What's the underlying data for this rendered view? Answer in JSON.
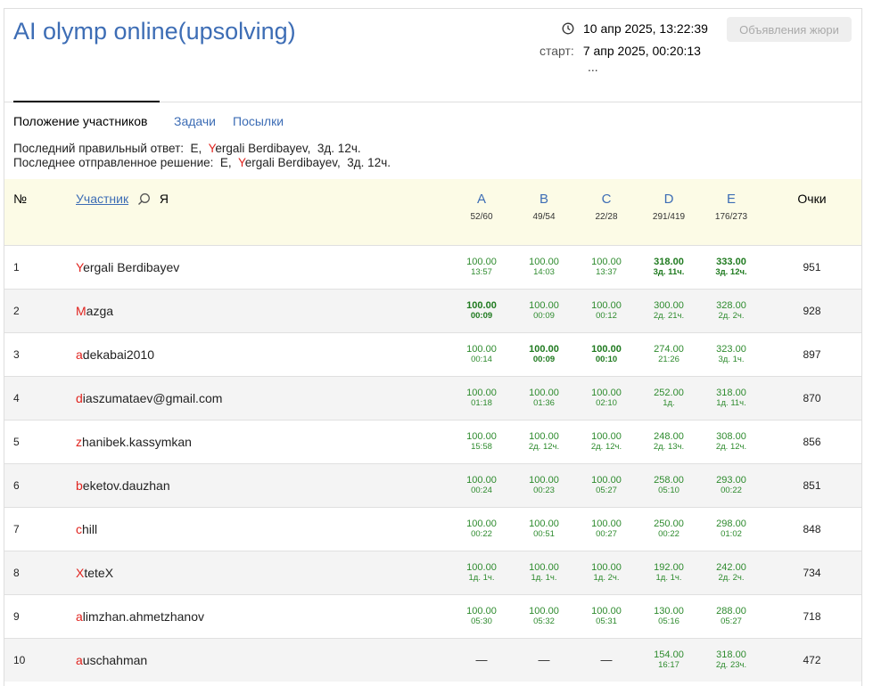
{
  "contest": {
    "title": "AI olymp online(upsolving)",
    "current_time": "10 апр 2025, 13:22:39",
    "start_label": "старт:",
    "start_time": "7 апр 2025, 00:20:13",
    "ellipsis": "...",
    "jury_button": "Объявления жюри"
  },
  "tabs": [
    {
      "label": "Положение участников"
    },
    {
      "label": "Задачи"
    },
    {
      "label": "Посылки"
    }
  ],
  "info": {
    "last_correct_label": "Последний правильный ответ:",
    "last_correct_problem": "E,",
    "last_correct_user_first": "Y",
    "last_correct_user_rest": "ergali Berdibayev,",
    "last_correct_time": "3д. 12ч.",
    "last_submit_label": "Последнее отправленное решение:",
    "last_submit_problem": "E,",
    "last_submit_user_first": "Y",
    "last_submit_user_rest": "ergali Berdibayev,",
    "last_submit_time": "3д. 12ч."
  },
  "table": {
    "col_num": "№",
    "col_participant": "Участник",
    "col_me": "Я",
    "col_score": "Очки",
    "problems": [
      {
        "letter": "A",
        "ratio": "52/60"
      },
      {
        "letter": "B",
        "ratio": "49/54"
      },
      {
        "letter": "C",
        "ratio": "22/28"
      },
      {
        "letter": "D",
        "ratio": "291/419"
      },
      {
        "letter": "E",
        "ratio": "176/273"
      }
    ],
    "rows": [
      {
        "rank": "1",
        "name_first": "Y",
        "name_rest": "ergali Berdibayev",
        "total": "951",
        "cells": [
          {
            "score": "100.00",
            "time": "13:57"
          },
          {
            "score": "100.00",
            "time": "14:03"
          },
          {
            "score": "100.00",
            "time": "13:37"
          },
          {
            "score": "318.00",
            "time": "3д. 11ч.",
            "first": true
          },
          {
            "score": "333.00",
            "time": "3д. 12ч.",
            "first": true
          }
        ]
      },
      {
        "rank": "2",
        "name_first": "M",
        "name_rest": "azga",
        "total": "928",
        "cells": [
          {
            "score": "100.00",
            "time": "00:09",
            "first": true
          },
          {
            "score": "100.00",
            "time": "00:09"
          },
          {
            "score": "100.00",
            "time": "00:12"
          },
          {
            "score": "300.00",
            "time": "2д. 21ч."
          },
          {
            "score": "328.00",
            "time": "2д. 2ч."
          }
        ]
      },
      {
        "rank": "3",
        "name_first": "a",
        "name_rest": "dekabai2010",
        "total": "897",
        "cells": [
          {
            "score": "100.00",
            "time": "00:14"
          },
          {
            "score": "100.00",
            "time": "00:09",
            "first": true
          },
          {
            "score": "100.00",
            "time": "00:10",
            "first": true
          },
          {
            "score": "274.00",
            "time": "21:26"
          },
          {
            "score": "323.00",
            "time": "3д. 1ч."
          }
        ]
      },
      {
        "rank": "4",
        "name_first": "d",
        "name_rest": "iaszumataev@gmail.com",
        "total": "870",
        "cells": [
          {
            "score": "100.00",
            "time": "01:18"
          },
          {
            "score": "100.00",
            "time": "01:36"
          },
          {
            "score": "100.00",
            "time": "02:10"
          },
          {
            "score": "252.00",
            "time": "1д."
          },
          {
            "score": "318.00",
            "time": "1д. 11ч."
          }
        ]
      },
      {
        "rank": "5",
        "name_first": "z",
        "name_rest": "hanibek.kassymkan",
        "total": "856",
        "cells": [
          {
            "score": "100.00",
            "time": "15:58"
          },
          {
            "score": "100.00",
            "time": "2д. 12ч."
          },
          {
            "score": "100.00",
            "time": "2д. 12ч."
          },
          {
            "score": "248.00",
            "time": "2д. 13ч."
          },
          {
            "score": "308.00",
            "time": "2д. 12ч."
          }
        ]
      },
      {
        "rank": "6",
        "name_first": "b",
        "name_rest": "eketov.dauzhan",
        "total": "851",
        "cells": [
          {
            "score": "100.00",
            "time": "00:24"
          },
          {
            "score": "100.00",
            "time": "00:23"
          },
          {
            "score": "100.00",
            "time": "05:27"
          },
          {
            "score": "258.00",
            "time": "05:10"
          },
          {
            "score": "293.00",
            "time": "00:22"
          }
        ]
      },
      {
        "rank": "7",
        "name_first": "c",
        "name_rest": "hill",
        "total": "848",
        "cells": [
          {
            "score": "100.00",
            "time": "00:22"
          },
          {
            "score": "100.00",
            "time": "00:51"
          },
          {
            "score": "100.00",
            "time": "00:27"
          },
          {
            "score": "250.00",
            "time": "00:22"
          },
          {
            "score": "298.00",
            "time": "01:02"
          }
        ]
      },
      {
        "rank": "8",
        "name_first": "X",
        "name_rest": "teteX",
        "total": "734",
        "cells": [
          {
            "score": "100.00",
            "time": "1д. 1ч."
          },
          {
            "score": "100.00",
            "time": "1д. 1ч."
          },
          {
            "score": "100.00",
            "time": "1д. 2ч."
          },
          {
            "score": "192.00",
            "time": "1д. 1ч."
          },
          {
            "score": "242.00",
            "time": "2д. 2ч."
          }
        ]
      },
      {
        "rank": "9",
        "name_first": "a",
        "name_rest": "limzhan.ahmetzhanov",
        "total": "718",
        "cells": [
          {
            "score": "100.00",
            "time": "05:30"
          },
          {
            "score": "100.00",
            "time": "05:32"
          },
          {
            "score": "100.00",
            "time": "05:31"
          },
          {
            "score": "130.00",
            "time": "05:16"
          },
          {
            "score": "288.00",
            "time": "05:27"
          }
        ]
      },
      {
        "rank": "10",
        "name_first": "a",
        "name_rest": "uschahman",
        "total": "472",
        "cells": [
          {
            "none": "—"
          },
          {
            "none": "—"
          },
          {
            "none": "—"
          },
          {
            "score": "154.00",
            "time": "16:17"
          },
          {
            "score": "318.00",
            "time": "2д. 23ч."
          }
        ]
      }
    ]
  }
}
